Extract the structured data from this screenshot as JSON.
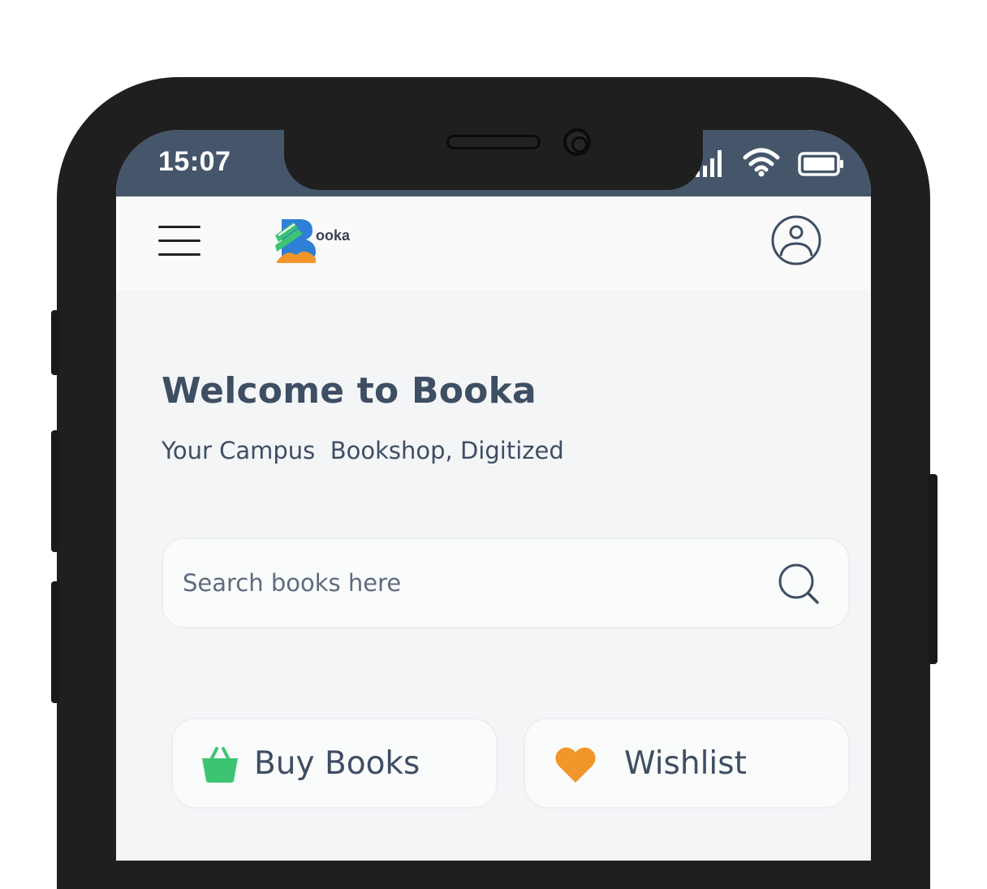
{
  "status_bar": {
    "time": "15:07",
    "signal_icon": "cellular-signal-icon",
    "wifi_icon": "wifi-icon",
    "battery_icon": "battery-icon"
  },
  "header": {
    "menu_icon": "hamburger-menu-icon",
    "logo_text": "ooka",
    "profile_icon": "user-profile-icon"
  },
  "welcome": {
    "title": "Welcome to Booka",
    "subtitle": "Your Campus  Bookshop, Digitized"
  },
  "search": {
    "placeholder": "Search books here",
    "value": "",
    "icon": "search-icon"
  },
  "actions": [
    {
      "label": "Buy Books",
      "icon": "shopping-basket-icon",
      "color": "#3dc472"
    },
    {
      "label": "Wishlist",
      "icon": "heart-icon",
      "color": "#f2952a"
    }
  ],
  "colors": {
    "status_bar": "#45566b",
    "text_primary": "#3e4e63",
    "screen_bg": "#f4f5f7",
    "logo_green": "#3dc472",
    "logo_blue": "#2f7fd6",
    "logo_orange": "#f2952a"
  }
}
